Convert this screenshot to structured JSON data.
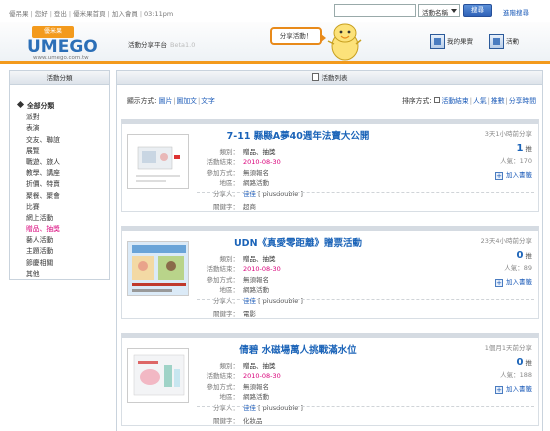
{
  "top": {
    "links": [
      "優吊果",
      "您好",
      "登出",
      "優米果首頁",
      "加入會員"
    ],
    "time": "03:11pm",
    "search_value": "",
    "search_select": "活動名稱",
    "search_button": "搜尋",
    "advanced_search": "進階搜尋"
  },
  "header": {
    "logo_top": "優米果",
    "logo_word": "UMEGO",
    "logo_url": "www.umego.com.tw",
    "platform": "活動分享平台",
    "beta": "Beta1.0",
    "share_bubble": "分享活動！",
    "nav_home": "我的果實",
    "nav_activity": "活動"
  },
  "sidebar": {
    "title": "活動分類",
    "items": [
      {
        "label": "全部分類"
      },
      {
        "label": "派對"
      },
      {
        "label": "表演"
      },
      {
        "label": "交友、聯誼"
      },
      {
        "label": "展覽"
      },
      {
        "label": "戰遊、旅人"
      },
      {
        "label": "教學、講座"
      },
      {
        "label": "折價、特賣"
      },
      {
        "label": "聚餐、聚會"
      },
      {
        "label": "比賽"
      },
      {
        "label": "網上活動"
      },
      {
        "label": "贈品、抽獎"
      },
      {
        "label": "藝人活動"
      },
      {
        "label": "主題活動"
      },
      {
        "label": "節慶相關"
      },
      {
        "label": "其他"
      }
    ],
    "active_index": 11
  },
  "main": {
    "title": "活動列表",
    "display_label": "顯示方式:",
    "display_options": [
      "圖片",
      "圖加文",
      "文字"
    ],
    "sort_label": "排序方式:",
    "sort_options": [
      "活動結束",
      "人氣",
      "推數",
      "分享時間"
    ]
  },
  "labels": {
    "category": "類別：",
    "end": "活動結束：",
    "method": "參加方式：",
    "location": "地區：",
    "sharer": "分享人：",
    "keyword": "關鍵字：",
    "recommend_unit": "推",
    "popularity": "人氣：",
    "bookmark": "加入書籤"
  },
  "cards": [
    {
      "title": "7-11 縣縣A夢40週年法寶大公開",
      "category": "贈品、抽獎",
      "end_date": "2010-08-30",
      "method": "無須報名",
      "location": "網路活動",
      "sharer": "佳佳",
      "sharer_id": "[ plusdouble ]",
      "keyword": "超商",
      "posted": "3天1小時前分享",
      "recommend": "1",
      "popularity": "170"
    },
    {
      "title": "UDN《真愛零距離》贈票活動",
      "category": "贈品、抽獎",
      "end_date": "2010-08-30",
      "method": "無須報名",
      "location": "網路活動",
      "sharer": "佳佳",
      "sharer_id": "[ plusdouble ]",
      "keyword": "電影",
      "posted": "23天4小時前分享",
      "recommend": "0",
      "popularity": "89"
    },
    {
      "title": "倩碧 水磁場萬人挑戰滿水位",
      "category": "贈品、抽獎",
      "end_date": "2010-08-30",
      "method": "無須報名",
      "location": "網路活動",
      "sharer": "佳佳",
      "sharer_id": "[ plusdouble ]",
      "keyword": "化妝品",
      "posted": "1個月1天前分享",
      "recommend": "0",
      "popularity": "188"
    }
  ]
}
